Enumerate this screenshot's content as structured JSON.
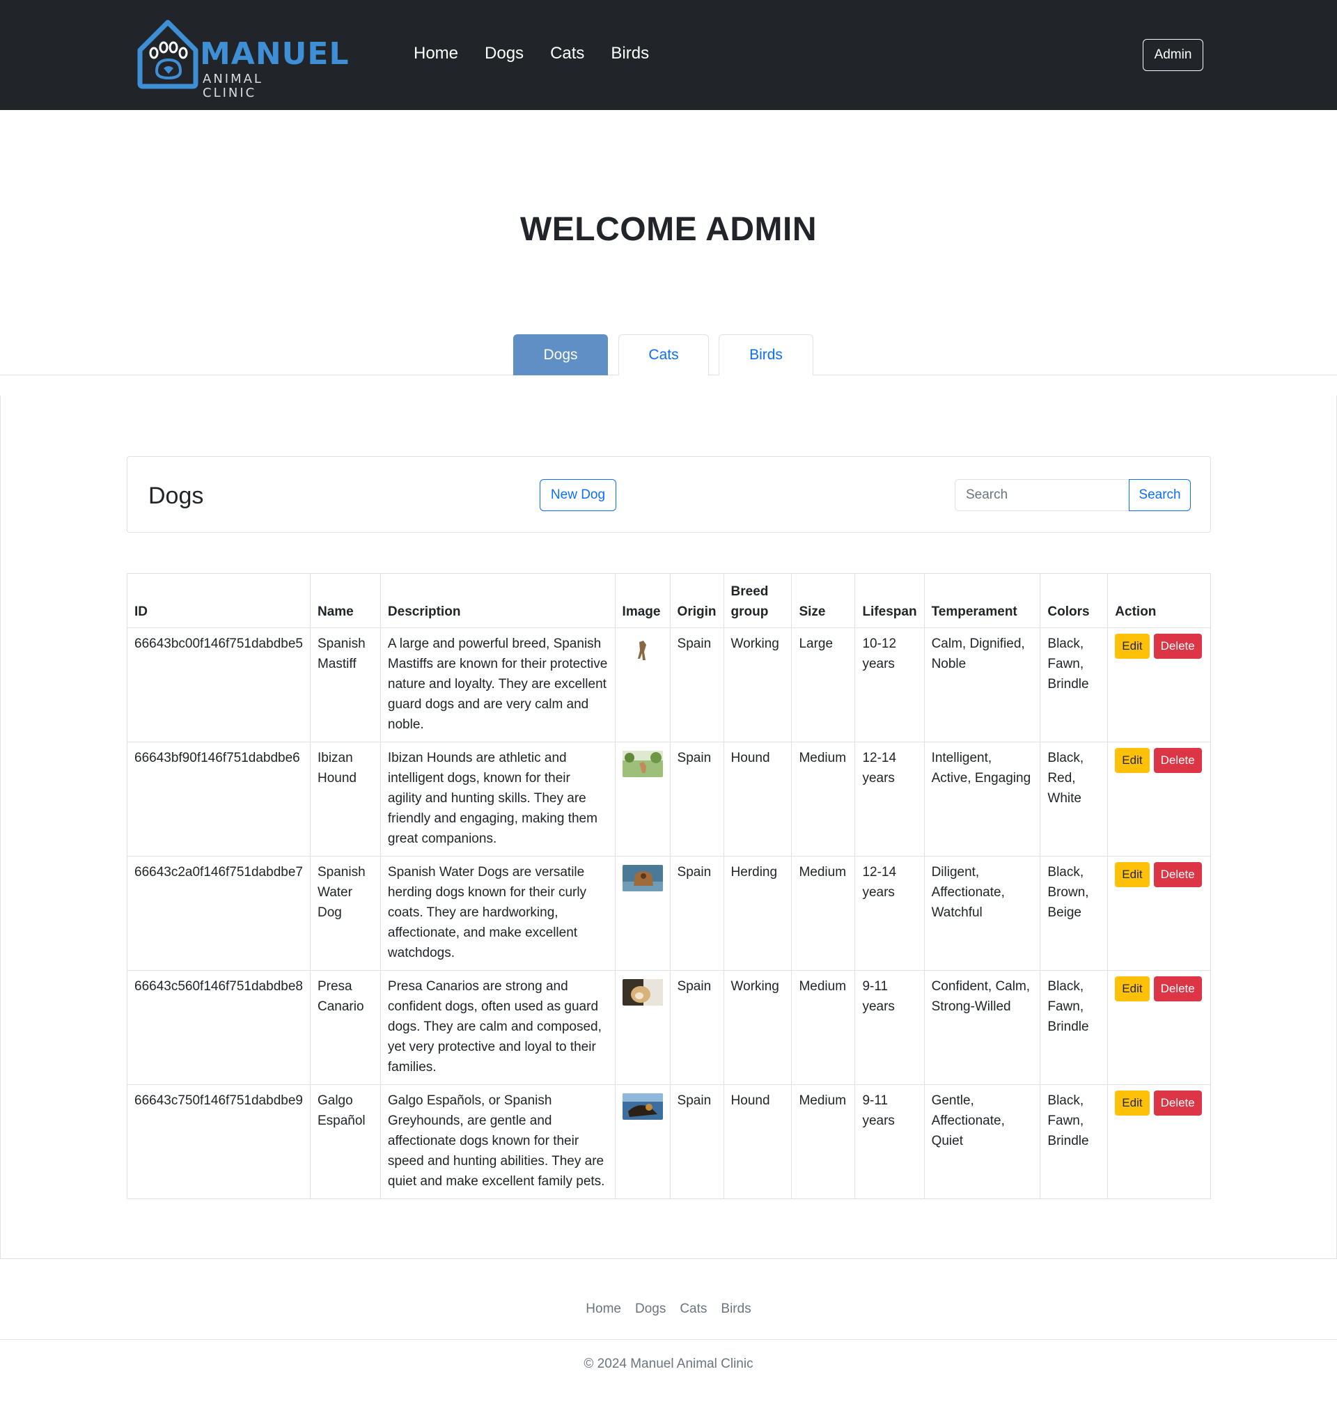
{
  "brand": {
    "title": "MANUEL",
    "subtitle": "ANIMAL CLINIC",
    "accent": "#3f8fd6"
  },
  "nav": {
    "links": [
      "Home",
      "Dogs",
      "Cats",
      "Birds"
    ],
    "admin_label": "Admin"
  },
  "welcome": "WELCOME ADMIN",
  "tabs": [
    {
      "label": "Dogs",
      "active": true
    },
    {
      "label": "Cats",
      "active": false
    },
    {
      "label": "Birds",
      "active": false
    }
  ],
  "panel": {
    "title": "Dogs",
    "new_button": "New Dog",
    "search_placeholder": "Search",
    "search_button": "Search"
  },
  "table": {
    "headers": [
      "ID",
      "Name",
      "Description",
      "Image",
      "Origin",
      "Breed group",
      "Size",
      "Lifespan",
      "Temperament",
      "Colors",
      "Action"
    ],
    "rows": [
      {
        "id": "66643bc00f146f751dabdbe5",
        "name": "Spanish Mastiff",
        "description": "A large and powerful breed, Spanish Mastiffs are known for their protective nature and loyalty. They are excellent guard dogs and are very calm and noble.",
        "origin": "Spain",
        "group": "Working",
        "size": "Large",
        "lifespan": "10-12 years",
        "temperament": "Calm, Dignified, Noble",
        "colors": "Black, Fawn, Brindle",
        "edit": "Edit",
        "delete": "Delete"
      },
      {
        "id": "66643bf90f146f751dabdbe6",
        "name": "Ibizan Hound",
        "description": "Ibizan Hounds are athletic and intelligent dogs, known for their agility and hunting skills. They are friendly and engaging, making them great companions.",
        "origin": "Spain",
        "group": "Hound",
        "size": "Medium",
        "lifespan": "12-14 years",
        "temperament": "Intelligent, Active, Engaging",
        "colors": "Black, Red, White",
        "edit": "Edit",
        "delete": "Delete"
      },
      {
        "id": "66643c2a0f146f751dabdbe7",
        "name": "Spanish Water Dog",
        "description": "Spanish Water Dogs are versatile herding dogs known for their curly coats. They are hardworking, affectionate, and make excellent watchdogs.",
        "origin": "Spain",
        "group": "Herding",
        "size": "Medium",
        "lifespan": "12-14 years",
        "temperament": "Diligent, Affectionate, Watchful",
        "colors": "Black, Brown, Beige",
        "edit": "Edit",
        "delete": "Delete"
      },
      {
        "id": "66643c560f146f751dabdbe8",
        "name": "Presa Canario",
        "description": "Presa Canarios are strong and confident dogs, often used as guard dogs. They are calm and composed, yet very protective and loyal to their families.",
        "origin": "Spain",
        "group": "Working",
        "size": "Medium",
        "lifespan": "9-11 years",
        "temperament": "Confident, Calm, Strong-Willed",
        "colors": "Black, Fawn, Brindle",
        "edit": "Edit",
        "delete": "Delete"
      },
      {
        "id": "66643c750f146f751dabdbe9",
        "name": "Galgo Español",
        "description": "Galgo Españols, or Spanish Greyhounds, are gentle and affectionate dogs known for their speed and hunting abilities. They are quiet and make excellent family pets.",
        "origin": "Spain",
        "group": "Hound",
        "size": "Medium",
        "lifespan": "9-11 years",
        "temperament": "Gentle, Affectionate, Quiet",
        "colors": "Black, Fawn, Brindle",
        "edit": "Edit",
        "delete": "Delete"
      }
    ]
  },
  "footer": {
    "links": [
      "Home",
      "Dogs",
      "Cats",
      "Birds"
    ],
    "copyright": "© 2024 Manuel Animal Clinic"
  }
}
